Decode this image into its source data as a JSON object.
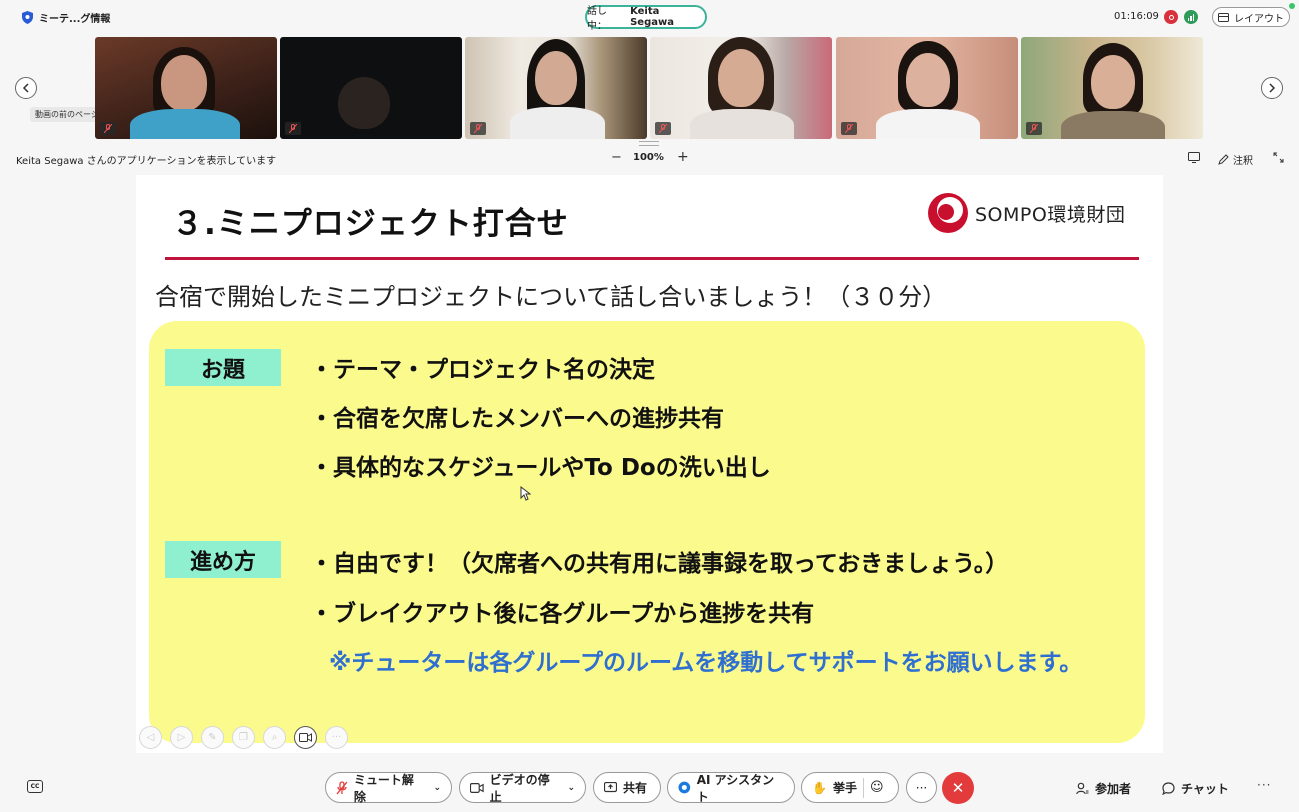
{
  "topbar": {
    "meeting_info": "ミーテ...グ情報",
    "speaking_prefix": "話し中：",
    "speaker_name": "Keita Segawa",
    "clock": "01:16:09",
    "layout_label": "レイアウト"
  },
  "video_strip": {
    "tooltip": "動画の前のページに移動"
  },
  "sharebar": {
    "label": "Keita Segawa さんのアプリケーションを表示しています",
    "zoom_minus": "−",
    "zoom_value": "100%",
    "zoom_plus": "+",
    "annotate_label": "注釈"
  },
  "slide": {
    "title": "３.ミニプロジェクト打合せ",
    "logo_text": "SOMPO環境財団",
    "subtitle": "合宿で開始したミニプロジェクトについて話し合いましょう！（３０分）",
    "topics_label": "お題",
    "topics": [
      "・テーマ・プロジェクト名の決定",
      "・合宿を欠席したメンバーへの進捗共有",
      "・具体的なスケジュールやTo Doの洗い出し"
    ],
    "method_label": "進め方",
    "method": [
      "・自由です！（欠席者への共有用に議事録を取っておきましょう。）",
      "・ブレイクアウト後に各グループから進捗を共有"
    ],
    "note": "※チューターは各グループのルームを移動してサポートをお願いします。"
  },
  "controls": {
    "cc": "CC",
    "mute": "ミュート解除",
    "video": "ビデオの停止",
    "share": "共有",
    "ai": "AI アシスタント",
    "raise_hand": "挙手",
    "more": "···",
    "participants": "参加者",
    "chat": "チャット",
    "more_right": "···"
  },
  "colors": {
    "speaking_border": "#3bb39a",
    "slide_rule": "#c0143c",
    "highlight": "#fbfa8d",
    "label_bg": "#8ff0cf",
    "note_blue": "#2f6fd0",
    "leave": "#e33b3b"
  }
}
